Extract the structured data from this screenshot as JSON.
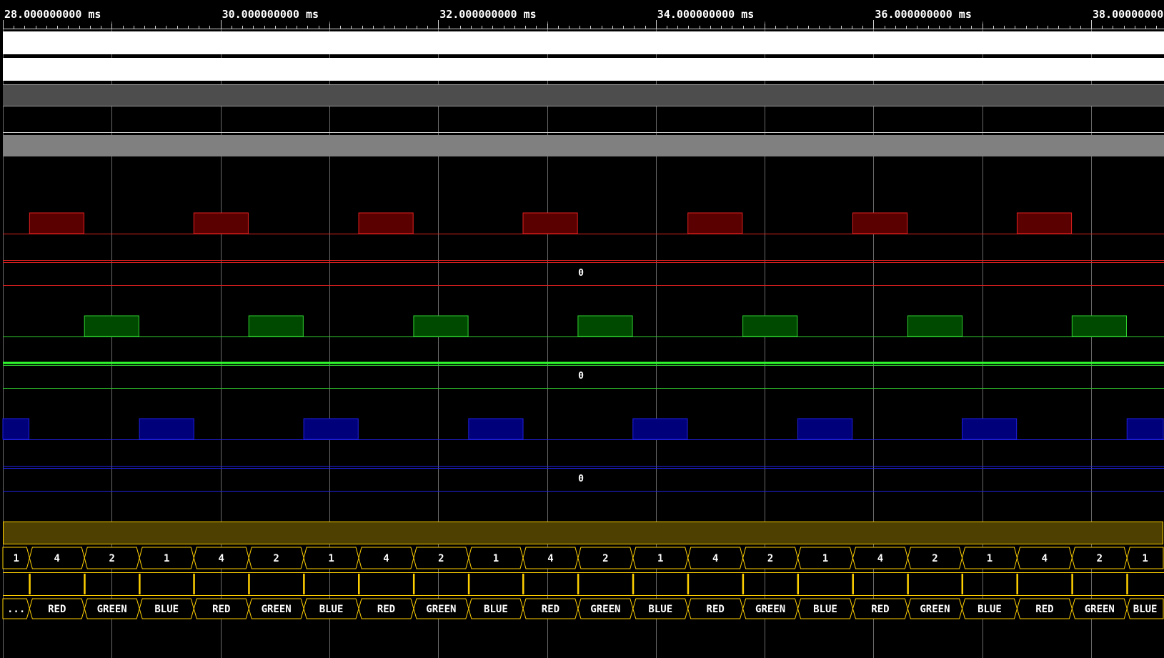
{
  "timeline": {
    "ticks": [
      {
        "t": 28,
        "label": "28.000000000 ms"
      },
      {
        "t": 30,
        "label": "30.000000000 ms"
      },
      {
        "t": 32,
        "label": "32.000000000 ms"
      },
      {
        "t": 34,
        "label": "34.000000000 ms"
      },
      {
        "t": 36,
        "label": "36.000000000 ms"
      },
      {
        "t": 38,
        "label": "38.00000000"
      }
    ],
    "unit": "ms",
    "view_start": 28.0,
    "view_end": 38.667,
    "minor_per_major": 20,
    "period": 3.022
  },
  "colors": {
    "background": "#000000",
    "grid": "#6a6a6a",
    "white_bus": "#ffffff",
    "dark_gray_bus": "#4d4d4d",
    "gray_bus": "#808080",
    "red_line": "#e02020",
    "red_fill": "#5a0000",
    "green_line": "#30d030",
    "green_fill": "#004a00",
    "green_bright": "#30ff30",
    "blue_line": "#2020e0",
    "blue_fill": "#00007a",
    "yellow_line": "#ffd000",
    "yellow_fill": "#4d4000"
  },
  "analog": {
    "zero_label": "0"
  },
  "pulses": {
    "red_starts": [
      28.245,
      29.755,
      31.27,
      32.78,
      34.295,
      35.81,
      37.32
    ],
    "green_starts": [
      28.75,
      30.26,
      31.775,
      33.285,
      34.8,
      36.315,
      37.825
    ],
    "blue_starts": [
      27.74,
      29.255,
      30.765,
      32.28,
      33.79,
      35.305,
      36.815,
      38.33
    ],
    "width": 0.5
  },
  "decode": {
    "cell_starts": [
      27.9,
      28.245,
      28.75,
      29.255,
      29.755,
      30.26,
      30.765,
      31.27,
      31.775,
      32.28,
      32.78,
      33.285,
      33.79,
      34.295,
      34.8,
      35.305,
      35.81,
      36.315,
      36.815,
      37.32,
      37.825,
      38.33
    ],
    "numbers": [
      "1",
      "4",
      "2",
      "1",
      "4",
      "2",
      "1",
      "4",
      "2",
      "1",
      "4",
      "2",
      "1",
      "4",
      "2",
      "1",
      "4",
      "2",
      "1",
      "4",
      "2",
      "1"
    ],
    "colors_row": [
      "...",
      "RED",
      "GREEN",
      "BLUE",
      "RED",
      "GREEN",
      "BLUE",
      "RED",
      "GREEN",
      "BLUE",
      "RED",
      "GREEN",
      "BLUE",
      "RED",
      "GREEN",
      "BLUE",
      "RED",
      "GREEN",
      "BLUE",
      "RED",
      "GREEN",
      "BLUE"
    ],
    "strobe_times": [
      28.245,
      28.75,
      29.255,
      29.755,
      30.26,
      30.765,
      31.27,
      31.775,
      32.28,
      32.78,
      33.285,
      33.79,
      34.295,
      34.8,
      35.305,
      35.81,
      36.315,
      36.815,
      37.32,
      37.825,
      38.33
    ]
  }
}
